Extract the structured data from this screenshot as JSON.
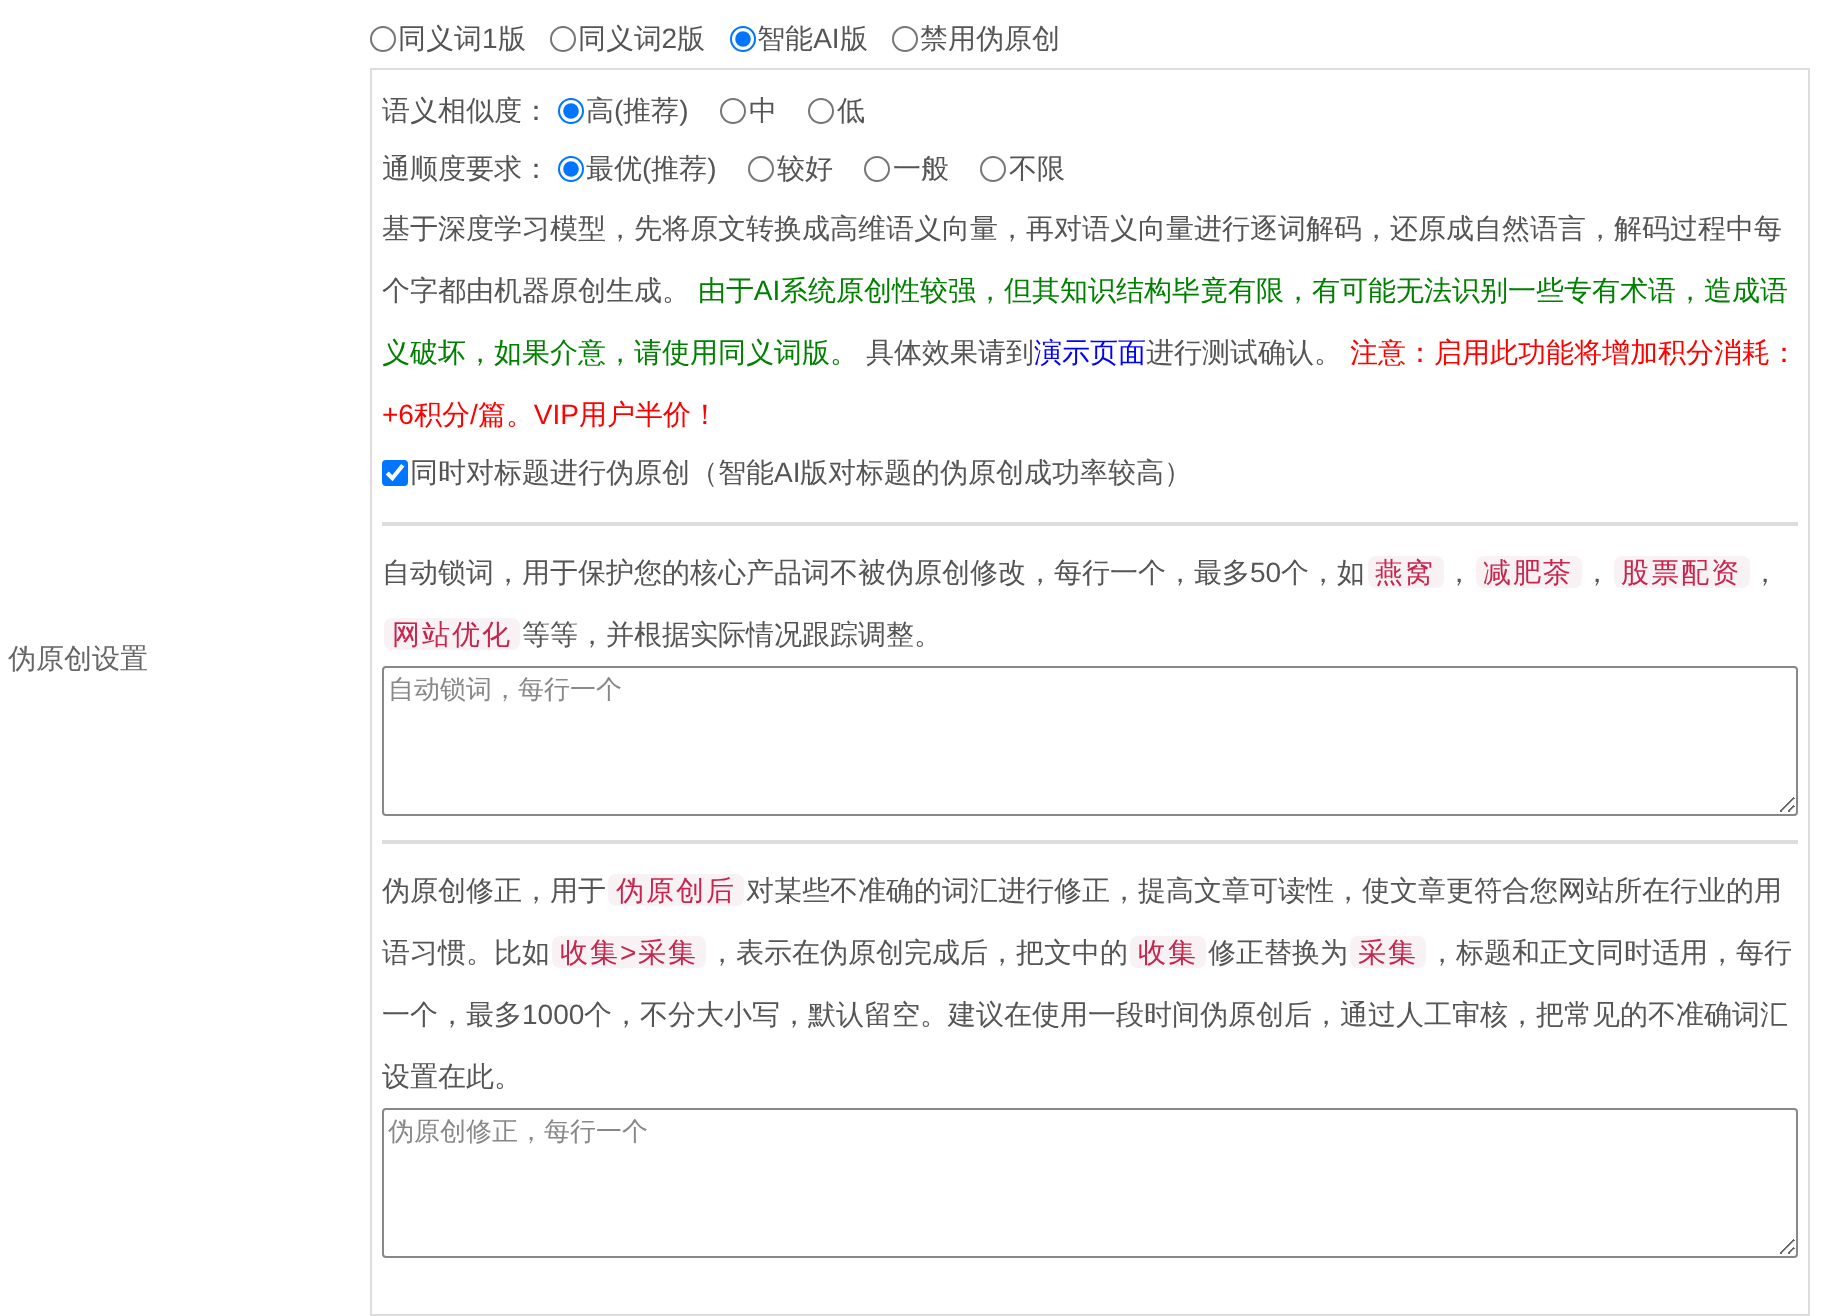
{
  "label": "伪原创设置",
  "modes": [
    {
      "label": "同义词1版",
      "selected": false
    },
    {
      "label": "同义词2版",
      "selected": false
    },
    {
      "label": "智能AI版",
      "selected": true
    },
    {
      "label": "禁用伪原创",
      "selected": false
    }
  ],
  "option_groups": [
    {
      "label": "语义相似度：",
      "options": [
        {
          "label": "高(推荐)",
          "selected": true
        },
        {
          "label": "中",
          "selected": false
        },
        {
          "label": "低",
          "selected": false
        }
      ]
    },
    {
      "label": "通顺度要求：",
      "options": [
        {
          "label": "最优(推荐)",
          "selected": true
        },
        {
          "label": "较好",
          "selected": false
        },
        {
          "label": "一般",
          "selected": false
        },
        {
          "label": "不限",
          "selected": false
        }
      ]
    }
  ],
  "description": [
    {
      "kind": "plain",
      "text": "基于深度学习模型，先将原文转换成高维语义向量，再对语义向量进行逐词解码，还原成自然语言，解码过程中每个字都由机器原创生成。 "
    },
    {
      "kind": "notice",
      "text": "由于AI系统原创性较强，但其知识结构毕竟有限，有可能无法识别一些专有术语，造成语义破坏，如果介意，请使用同义词版。"
    },
    {
      "kind": "plain",
      "text": " 具体效果请到"
    },
    {
      "kind": "link",
      "text": "演示页面"
    },
    {
      "kind": "plain",
      "text": "进行测试确认。 "
    },
    {
      "kind": "warning",
      "text": "注意：启用此功能将增加积分消耗：+6积分/篇。VIP用户半价！"
    }
  ],
  "title_option": {
    "label": "同时对标题进行伪原创（智能AI版对标题的伪原创成功率较高）",
    "checked": true
  },
  "sections": [
    {
      "description": [
        {
          "kind": "plain",
          "text": "自动锁词，用于保护您的核心产品词不被伪原创修改，每行一个，最多50个，如"
        },
        {
          "kind": "code",
          "text": "燕窝"
        },
        {
          "kind": "plain",
          "text": "，"
        },
        {
          "kind": "code",
          "text": "减肥茶"
        },
        {
          "kind": "plain",
          "text": "，"
        },
        {
          "kind": "code",
          "text": "股票配资"
        },
        {
          "kind": "plain",
          "text": "，"
        },
        {
          "kind": "code",
          "text": "网站优化"
        },
        {
          "kind": "plain",
          "text": "等等，并根据实际情况跟踪调整。"
        }
      ],
      "placeholder": "自动锁词，每行一个"
    },
    {
      "description": [
        {
          "kind": "plain",
          "text": "伪原创修正，用于"
        },
        {
          "kind": "code",
          "text": "伪原创后"
        },
        {
          "kind": "plain",
          "text": "对某些不准确的词汇进行修正，提高文章可读性，使文章更符合您网站所在行业的用语习惯。比如"
        },
        {
          "kind": "code",
          "text": "收集>采集"
        },
        {
          "kind": "plain",
          "text": "，表示在伪原创完成后，把文中的"
        },
        {
          "kind": "code",
          "text": "收集"
        },
        {
          "kind": "plain",
          "text": "修正替换为"
        },
        {
          "kind": "code",
          "text": "采集"
        },
        {
          "kind": "plain",
          "text": "，标题和正文同时适用，每行一个，最多1000个，不分大小写，默认留空。建议在使用一段时间伪原创后，通过人工审核，把常见的不准确词汇设置在此。"
        }
      ],
      "placeholder": "伪原创修正，每行一个"
    }
  ]
}
